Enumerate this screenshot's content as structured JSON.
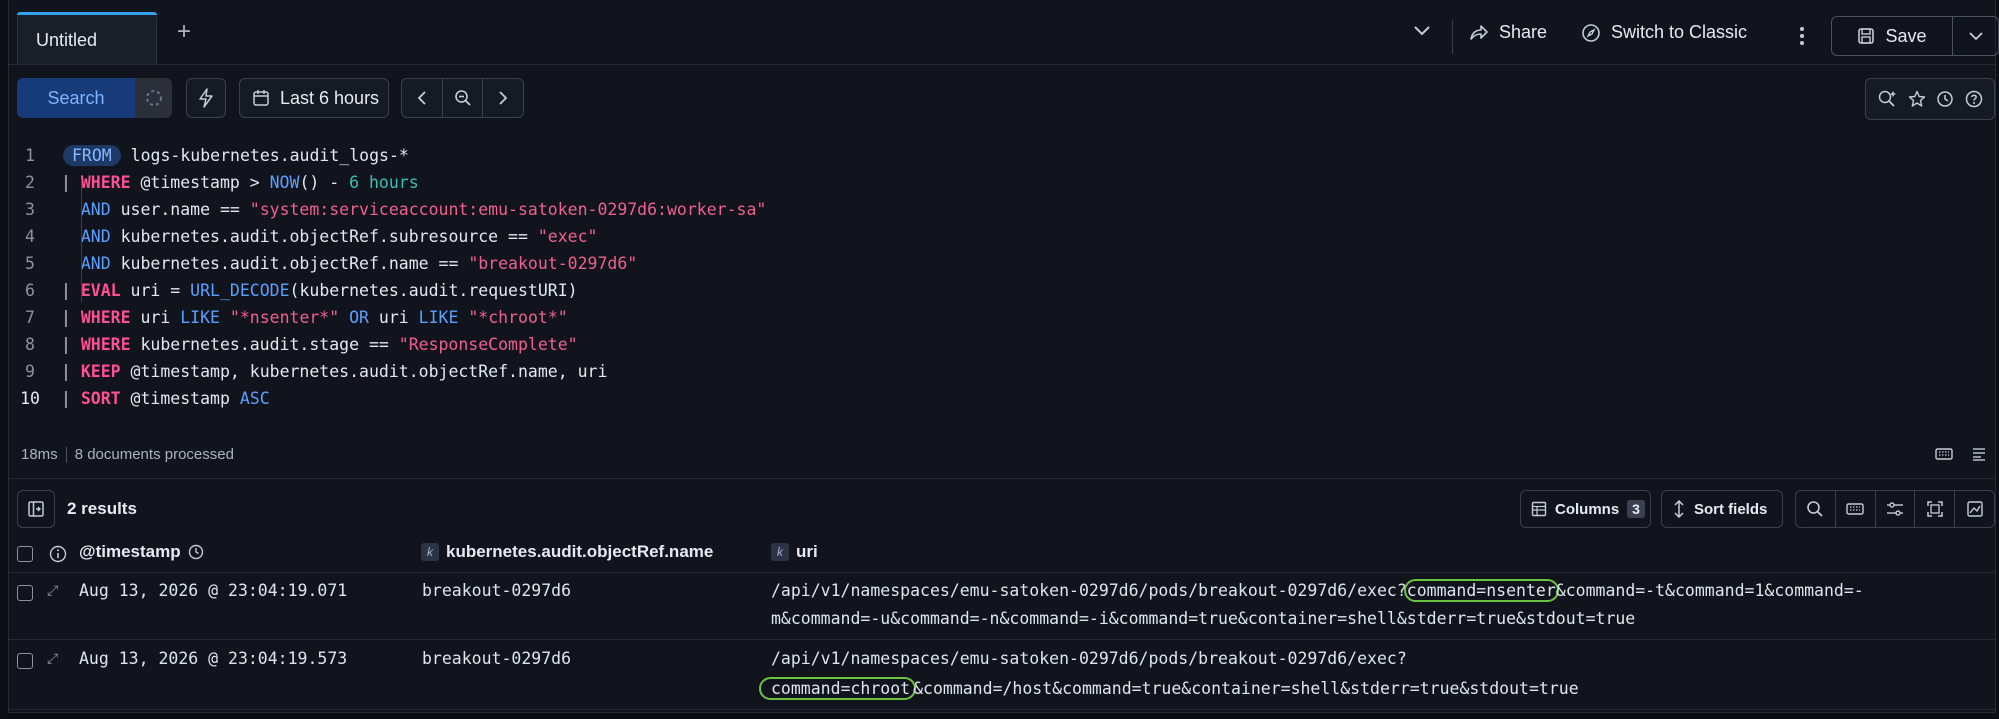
{
  "tabs": {
    "active": "Untitled",
    "add_symbol": "+"
  },
  "header": {
    "share": "Share",
    "switch_classic": "Switch to Classic",
    "save": "Save"
  },
  "toolbar": {
    "search": "Search",
    "date_range": "Last 6 hours"
  },
  "editor": {
    "line_numbers": [
      "1",
      "2",
      "3",
      "4",
      "5",
      "6",
      "7",
      "8",
      "9",
      "10"
    ]
  },
  "status": {
    "time": "18ms",
    "processed": "8 documents processed"
  },
  "results": {
    "count": "2 results",
    "columns_label": "Columns",
    "columns_count": "3",
    "sort_label": "Sort fields",
    "headers": [
      "@timestamp",
      "kubernetes.audit.objectRef.name",
      "uri"
    ],
    "field_type_badge": "k",
    "rows": [
      {
        "timestamp": "Aug 13, 2026 @ 23:04:19.071",
        "name": "breakout-0297d6",
        "uri_line1_pre": "/api/v1/namespaces/emu-satoken-0297d6/pods/breakout-0297d6/exec?",
        "uri_line1_hl": "command=nsenter",
        "uri_line1_post": "&command=-t&command=1&command=-",
        "uri_line2": "m&command=-u&command=-n&command=-i&command=true&container=shell&stderr=true&stdout=true"
      },
      {
        "timestamp": "Aug 13, 2026 @ 23:04:19.573",
        "name": "breakout-0297d6",
        "uri_line1": "/api/v1/namespaces/emu-satoken-0297d6/pods/breakout-0297d6/exec?",
        "uri_line2_hl": "command=chroot",
        "uri_line2_post": "&command=/host&command=true&container=shell&stderr=true&stdout=true"
      }
    ]
  },
  "colors": {
    "accent": "#36a2ef",
    "keyword": "#ff4f96",
    "string": "#f0608f",
    "number": "#36c2b4",
    "function": "#5aa0ff",
    "highlight_outline": "#6bc441"
  }
}
